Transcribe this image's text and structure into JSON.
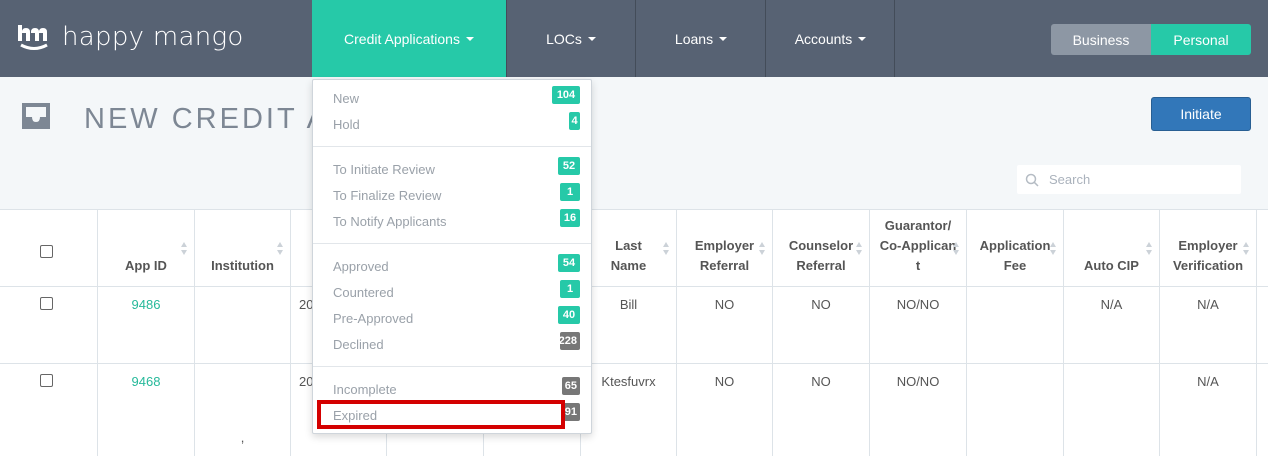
{
  "brand": {
    "name": "happy mango",
    "logo_letters": "hm"
  },
  "nav": {
    "credit_applications": "Credit Applications",
    "locs": "LOCs",
    "loans": "Loans",
    "accounts": "Accounts"
  },
  "mode_toggle": {
    "business": "Business",
    "personal": "Personal",
    "selected": "Personal"
  },
  "page": {
    "title": "NEW CREDIT A",
    "initiate_label": "Initiate"
  },
  "search": {
    "placeholder": "Search"
  },
  "table": {
    "headers": {
      "app_id": "App ID",
      "institution": "Institution",
      "col_c": "",
      "col_d": "",
      "col_e": "",
      "last_name": [
        "Last",
        "Name"
      ],
      "employer_referral": [
        "Employer",
        "Referral"
      ],
      "counselor_referral": [
        "Counselor",
        "Referral"
      ],
      "guarantor": [
        "Guarantor/",
        "Co-Applican",
        "t"
      ],
      "application_fee": [
        "Application",
        "Fee"
      ],
      "auto_cip": "Auto CIP",
      "employer_verification": [
        "Employer",
        "Verification"
      ]
    },
    "rows": [
      {
        "app_id": "9486",
        "institution": "",
        "col_c": "20",
        "last_name": "Bill",
        "employer_referral": "NO",
        "counselor_referral": "NO",
        "guarantor": "NO/NO",
        "application_fee": "",
        "auto_cip": "N/A",
        "employer_verification": "N/A"
      },
      {
        "app_id": "9468",
        "institution": ",",
        "col_c": "20",
        "last_name": "Ktesfuvrx",
        "employer_referral": "NO",
        "counselor_referral": "NO",
        "guarantor": "NO/NO",
        "application_fee": "",
        "auto_cip": "",
        "employer_verification": "N/A"
      }
    ]
  },
  "dropdown": {
    "groups": [
      [
        {
          "label": "New",
          "count": "104"
        },
        {
          "label": "Hold",
          "count": "4"
        }
      ],
      [
        {
          "label": "To Initiate Review",
          "count": "52"
        },
        {
          "label": "To Finalize Review",
          "count": "1"
        },
        {
          "label": "To Notify Applicants",
          "count": "16"
        }
      ],
      [
        {
          "label": "Approved",
          "count": "54"
        },
        {
          "label": "Countered",
          "count": "1"
        },
        {
          "label": "Pre-Approved",
          "count": "40"
        },
        {
          "label": "Declined",
          "count": "228"
        }
      ],
      [
        {
          "label": "Incomplete",
          "count": "65"
        },
        {
          "label": "Expired",
          "count": "91"
        }
      ]
    ]
  },
  "colors": {
    "nav_bg": "#576273",
    "accent": "#26c9a8",
    "primary_button": "#3277b9",
    "highlight": "#d40000"
  }
}
